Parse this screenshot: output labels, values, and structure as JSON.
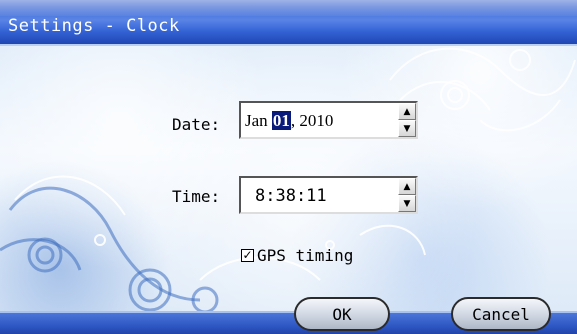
{
  "window": {
    "title": "Settings - Clock",
    "colors": {
      "title_bar": "#3564d6",
      "selection": "#0a1a7a",
      "background": "#e9f2fb"
    }
  },
  "form": {
    "date": {
      "label": "Date:",
      "value_month": "Jan ",
      "value_day_selected": "01",
      "value_year": ", 2010",
      "up_icon": "spin-up-arrow",
      "down_icon": "spin-down-arrow"
    },
    "time": {
      "label": "Time:",
      "value": "8:38:11",
      "up_icon": "spin-up-arrow",
      "down_icon": "spin-down-arrow"
    },
    "gps_timing": {
      "label": "GPS timing",
      "checked": true,
      "check_glyph": "☑"
    }
  },
  "buttons": {
    "ok_label": "OK",
    "cancel_label": "Cancel"
  }
}
